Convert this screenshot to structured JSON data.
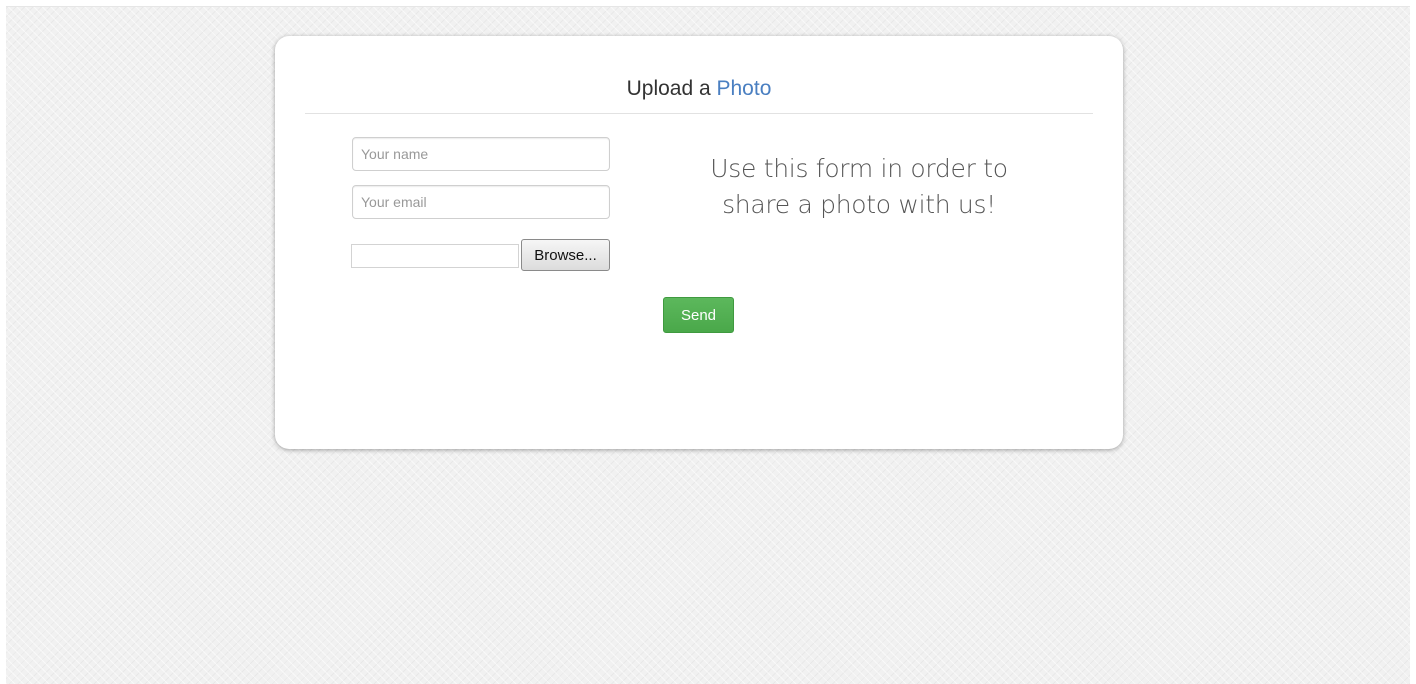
{
  "form": {
    "title_prefix": "Upload a",
    "title_accent": "Photo",
    "name_placeholder": "Your name",
    "email_placeholder": "Your email",
    "browse_label": "Browse...",
    "promo_line1": "Use this form in order to",
    "promo_line2": "share a photo with us!",
    "send_label": "Send"
  },
  "colors": {
    "accent": "#4a7fc1",
    "send_button": "#5cb85c",
    "background": "#f1f1f1"
  }
}
